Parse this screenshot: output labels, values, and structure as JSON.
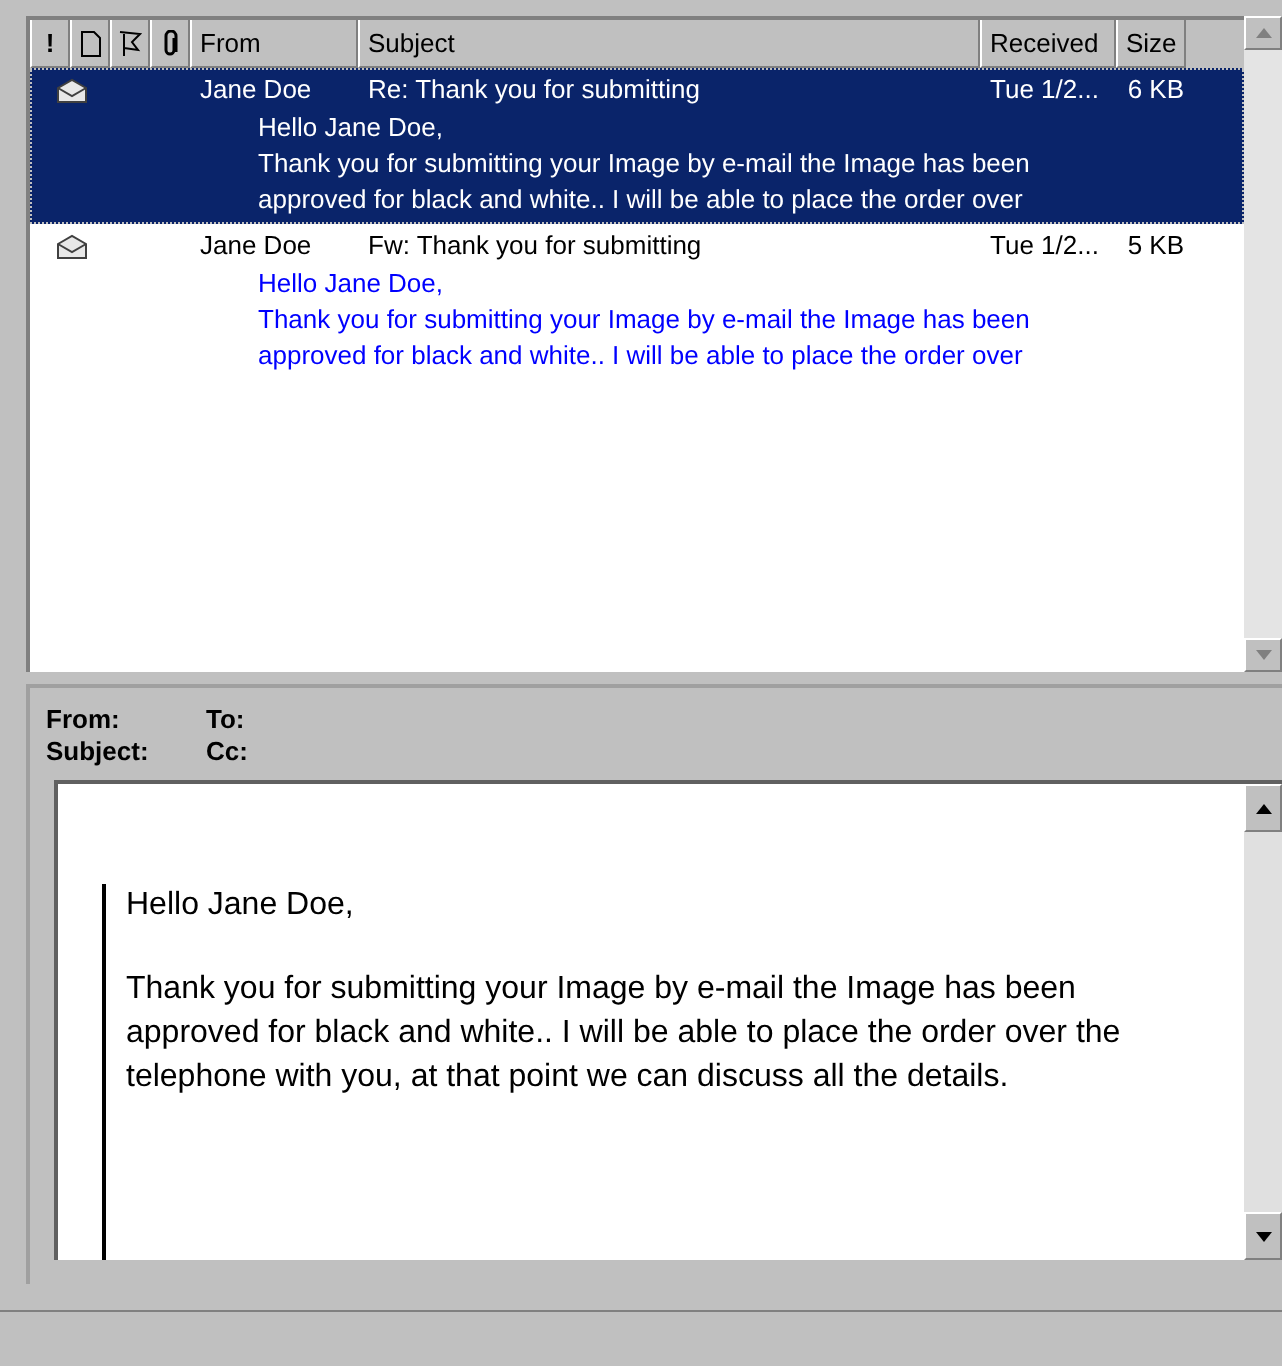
{
  "columns": [
    {
      "kind": "importance",
      "label": "!"
    },
    {
      "kind": "icon"
    },
    {
      "kind": "flag"
    },
    {
      "kind": "attachment"
    },
    {
      "kind": "text",
      "label": "From"
    },
    {
      "kind": "text",
      "label": "Subject"
    },
    {
      "kind": "text",
      "label": "Received"
    },
    {
      "kind": "text",
      "label": "Size"
    }
  ],
  "messages": [
    {
      "selected": true,
      "from": "Jane Doe",
      "subject": "Re: Thank you for submitting",
      "received": "Tue 1/2...",
      "size": "6 KB",
      "preview_lines": [
        "Hello Jane Doe,",
        "Thank you for submitting your Image by e-mail the Image has been",
        "approved for black and white.. I will be able to place the order over"
      ]
    },
    {
      "selected": false,
      "from": "Jane Doe",
      "subject": "Fw: Thank you for submitting",
      "received": "Tue 1/2...",
      "size": "5 KB",
      "preview_lines": [
        "Hello Jane Doe,",
        "Thank you for submitting your Image by e-mail the Image has been",
        "approved for black and white.. I will be able to place the order over"
      ]
    }
  ],
  "preview_header": {
    "from_label": "From:",
    "to_label": "To:",
    "subject_label": "Subject:",
    "cc_label": "Cc:"
  },
  "body": {
    "greeting": "Hello Jane Doe,",
    "paragraph": "Thank you for submitting your Image by e-mail the Image has been approved for black and white.. I will be able to place the order over the telephone with you, at that point we can discuss all the details."
  }
}
